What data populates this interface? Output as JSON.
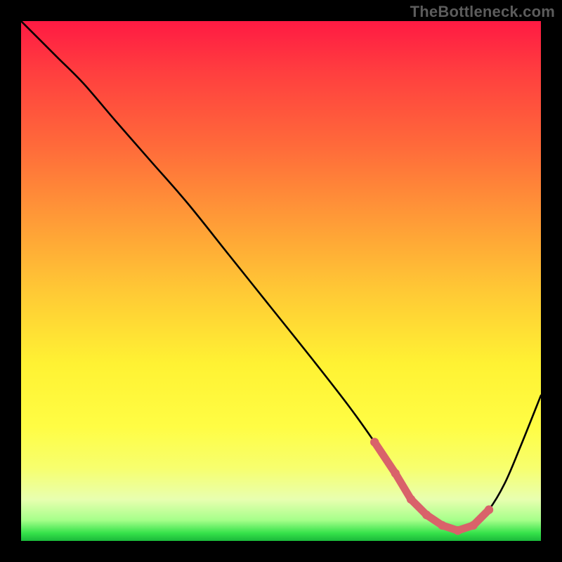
{
  "watermark": "TheBottleneck.com",
  "colors": {
    "background": "#000000",
    "curve": "#000000",
    "marker": "#d9626a",
    "gradient_top": "#ff1a43",
    "gradient_bottom": "#1ab83a"
  },
  "chart_data": {
    "type": "line",
    "title": "",
    "xlabel": "",
    "ylabel": "",
    "xlim": [
      0,
      100
    ],
    "ylim": [
      0,
      100
    ],
    "series": [
      {
        "name": "bottleneck-curve",
        "x": [
          0,
          3,
          7,
          12,
          18,
          25,
          32,
          40,
          48,
          56,
          63,
          68,
          72,
          75,
          78,
          81,
          84,
          87,
          90,
          93,
          96,
          100
        ],
        "values": [
          100,
          97,
          93,
          88,
          81,
          73,
          65,
          55,
          45,
          35,
          26,
          19,
          13,
          8,
          5,
          3,
          2,
          3,
          6,
          11,
          18,
          28
        ]
      }
    ],
    "annotations": [
      {
        "name": "optimal-range-marker",
        "type": "path",
        "x": [
          68,
          72,
          75,
          78,
          81,
          84,
          87,
          90
        ],
        "values": [
          19,
          13,
          8,
          5,
          3,
          2,
          3,
          6
        ]
      }
    ]
  }
}
